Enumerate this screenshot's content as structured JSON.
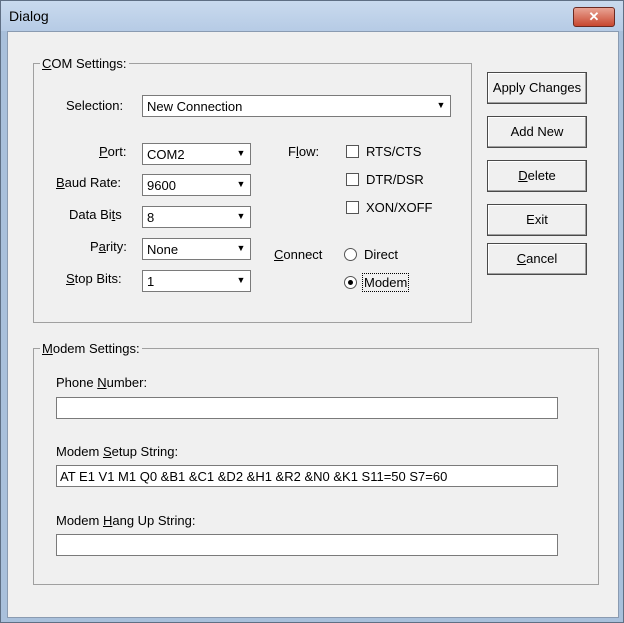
{
  "window": {
    "title": "Dialog",
    "close_label": "✕"
  },
  "com": {
    "group_label": "COM Settings:",
    "selection_label": "Selection:",
    "selection_value": "New Connection",
    "port_label": "Port:",
    "port_value": "COM2",
    "baud_label": "Baud Rate:",
    "baud_value": "9600",
    "databits_label": "Data Bits",
    "databits_value": "8",
    "parity_label": "Parity:",
    "parity_value": "None",
    "stopbits_label": "Stop Bits:",
    "stopbits_value": "1",
    "flow_label": "Flow:",
    "flow_options": [
      "RTS/CTS",
      "DTR/DSR",
      "XON/XOFF"
    ],
    "connect_label": "Connect",
    "connect_options": [
      "Direct",
      "Modem"
    ],
    "connect_selected": "Modem"
  },
  "buttons": {
    "apply": "Apply Changes",
    "add": "Add New",
    "delete": "Delete",
    "exit": "Exit",
    "cancel": "Cancel"
  },
  "modem": {
    "group_label": "Modem Settings:",
    "phone_label": "Phone Number:",
    "phone_value": "",
    "setup_label": "Modem Setup String:",
    "setup_value": "AT E1 V1 M1 Q0 &B1 &C1 &D2 &H1 &R2 &N0 &K1 S11=50 S7=60",
    "hangup_label": "Modem Hang Up String:",
    "hangup_value": ""
  }
}
